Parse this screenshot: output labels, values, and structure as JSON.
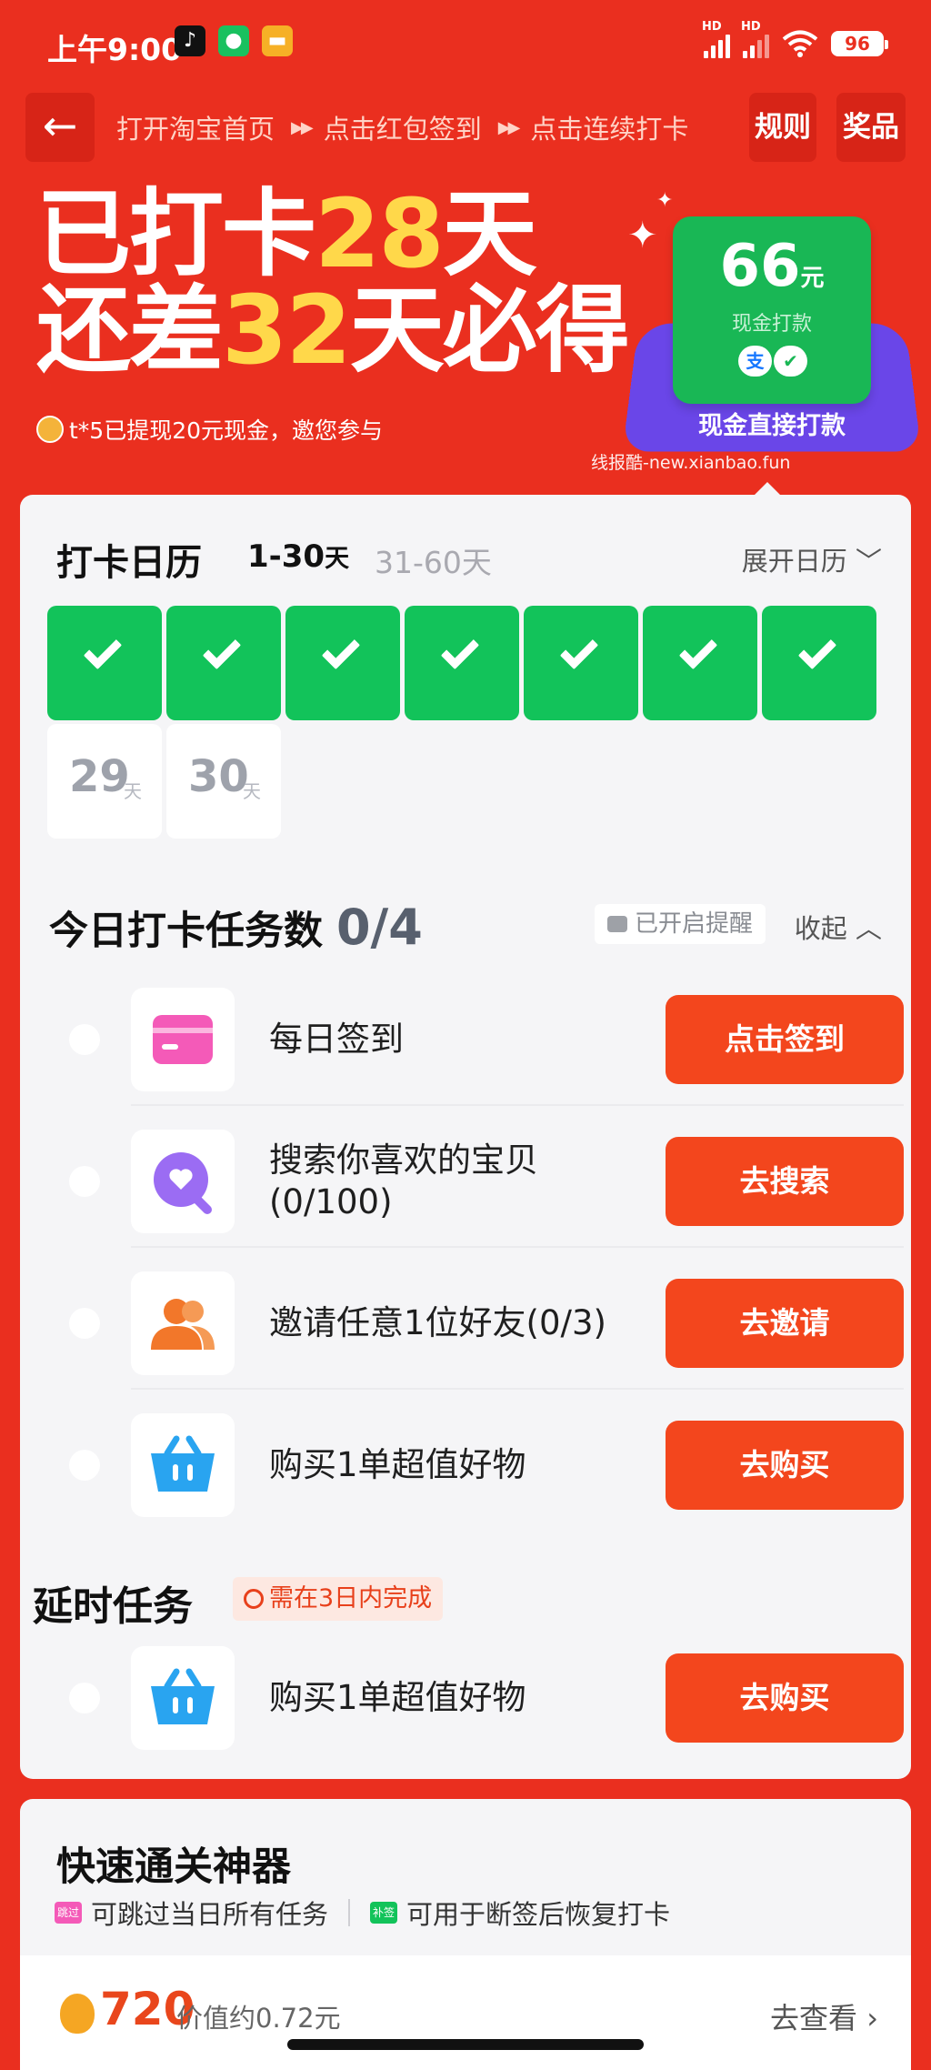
{
  "status_bar": {
    "time": "上午9:00",
    "net_label": "HD",
    "battery": "96",
    "app_icons": [
      "tiktok-icon",
      "wechat-icon",
      "notes-icon"
    ]
  },
  "header": {
    "back_icon": "arrow-left-icon",
    "steps": [
      "打开淘宝首页",
      "点击红包签到",
      "点击连续打卡"
    ],
    "step_arrow": "▶▶",
    "rules_label": "规则",
    "prize_label": "奖品"
  },
  "headline": {
    "line1_prefix": "已打卡",
    "line1_num": "28",
    "line1_suffix": "天",
    "line2_prefix": "还差",
    "line2_num": "32",
    "line2_suffix": "天必得",
    "ticker": "t*5已提现20元现金，邀您参与",
    "watermark": "线报酷-new.xianbao.fun"
  },
  "reward": {
    "amount": "66",
    "unit": "元",
    "subtitle": "现金打款",
    "alipay_glyph": "支",
    "label": "现金直接打款"
  },
  "calendar": {
    "title": "打卡日历",
    "tab_active": "1-30",
    "tab_active_unit": "天",
    "tab_other": "31-60天",
    "expand_label": "展开日历",
    "completed_days": 7,
    "pending": [
      {
        "num": "29",
        "unit": "天"
      },
      {
        "num": "30",
        "unit": "天"
      }
    ]
  },
  "tasks": {
    "title": "今日打卡任务数",
    "count": "0/4",
    "reminder": "已开启提醒",
    "collapse_label": "收起",
    "items": [
      {
        "label": "每日签到",
        "button": "点击签到",
        "icon": "card-icon"
      },
      {
        "label": "搜索你喜欢的宝贝(0/100)",
        "button": "去搜索",
        "icon": "search-heart-icon"
      },
      {
        "label": "邀请任意1位好友(0/3)",
        "button": "去邀请",
        "icon": "friends-icon"
      },
      {
        "label": "购买1单超值好物",
        "button": "去购买",
        "icon": "basket-icon"
      }
    ]
  },
  "delayed": {
    "title": "延时任务",
    "badge": "需在3日内完成",
    "item": {
      "label": "购买1单超值好物",
      "button": "去购买",
      "icon": "basket-icon"
    }
  },
  "tool": {
    "title": "快速通关神器",
    "feature1": "可跳过当日所有任务",
    "feature1_tag": "跳过",
    "feature2": "可用于断签后恢复打卡",
    "feature2_tag": "补签",
    "coins": "720",
    "value_text": "价值约0.72元",
    "go_label": "去查看"
  },
  "colors": {
    "background": "#ea2f1f",
    "accent_yellow": "#ffd84a",
    "done_green": "#12c35a",
    "button_orange": "#f3461d",
    "purple": "#6a46e8"
  }
}
